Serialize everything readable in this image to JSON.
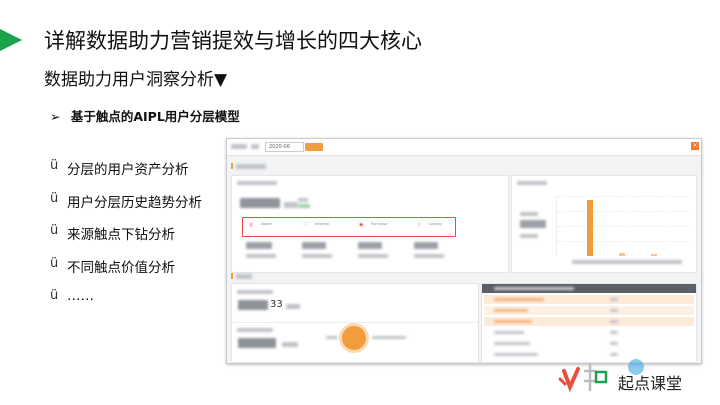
{
  "slide": {
    "title": "详解数据助力营销提效与增长的四大核心",
    "subtitle": "数据助力用户洞察分析▼",
    "section_marker": "➢",
    "section_heading": "基于触点的AIPL用户分层模型",
    "bullet_marker": "ü",
    "bullets": [
      "分层的用户资产分析",
      "用户分层历史趋势分析",
      "来源触点下钻分析",
      "不同触点价值分析",
      "……"
    ]
  },
  "screenshot": {
    "date_value": "2020-06",
    "big_number": "33",
    "stage_labels": [
      "Aware",
      "Interest",
      "Purchase",
      "Loyalty"
    ]
  },
  "logo": {
    "brand_text": "起点课堂",
    "colors": {
      "green": "#1aa34a",
      "red": "#e94e3c",
      "blue": "#2f9fdc"
    }
  },
  "colors": {
    "accent_green": "#1aa34a",
    "screenshot_orange": "#f39c3d",
    "funnel_red": "#e94e3c"
  }
}
